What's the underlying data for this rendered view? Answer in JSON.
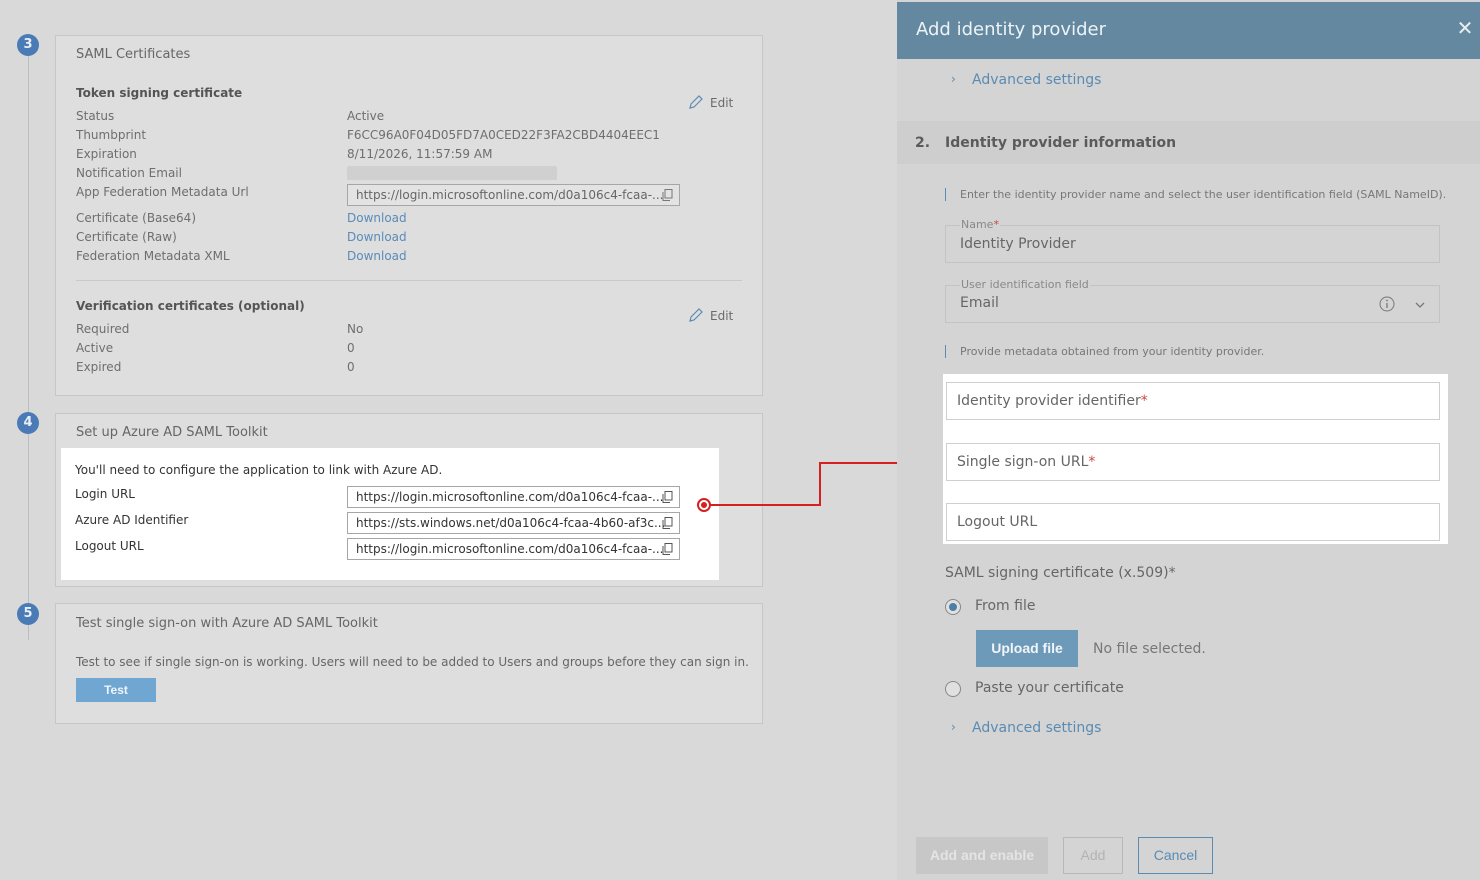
{
  "left": {
    "steps": [
      "3",
      "4",
      "5"
    ],
    "saml_certs": {
      "title": "SAML Certificates",
      "token_signing": {
        "heading": "Token signing certificate",
        "edit_label": "Edit",
        "rows": [
          {
            "label": "Status",
            "value": "Active"
          },
          {
            "label": "Thumbprint",
            "value": "F6CC96A0F04D05FD7A0CED22F3FA2CBD4404EEC1"
          },
          {
            "label": "Expiration",
            "value": "8/11/2026, 11:57:59 AM"
          },
          {
            "label": "Notification Email",
            "value": ""
          },
          {
            "label": "App Federation Metadata Url",
            "value": "https://login.microsoftonline.com/d0a106c4-fcaa-..."
          },
          {
            "label": "Certificate (Base64)",
            "value": "Download"
          },
          {
            "label": "Certificate (Raw)",
            "value": "Download"
          },
          {
            "label": "Federation Metadata XML",
            "value": "Download"
          }
        ]
      },
      "verification": {
        "heading": "Verification certificates (optional)",
        "edit_label": "Edit",
        "rows": [
          {
            "label": "Required",
            "value": "No"
          },
          {
            "label": "Active",
            "value": "0"
          },
          {
            "label": "Expired",
            "value": "0"
          }
        ]
      }
    },
    "setup": {
      "title": "Set up Azure AD SAML Toolkit",
      "intro": "You'll need to configure the application to link with Azure AD.",
      "rows": [
        {
          "label": "Login URL",
          "value": "https://login.microsoftonline.com/d0a106c4-fcaa-..."
        },
        {
          "label": "Azure AD Identifier",
          "value": "https://sts.windows.net/d0a106c4-fcaa-4b60-af3c..."
        },
        {
          "label": "Logout URL",
          "value": "https://login.microsoftonline.com/d0a106c4-fcaa-..."
        }
      ]
    },
    "test": {
      "title": "Test single sign-on with Azure AD SAML Toolkit",
      "desc": "Test to see if single sign-on is working. Users will need to be added to Users and groups before they can sign in.",
      "button": "Test"
    }
  },
  "panel": {
    "title": "Add identity provider",
    "close": "✕",
    "advanced_top": "Advanced settings",
    "section_num": "2.",
    "section_title": "Identity provider information",
    "hint1": "Enter the identity provider name and select the user identification field (SAML NameID).",
    "name_label": "Name",
    "name_value": "Identity Provider",
    "uid_label": "User identification field",
    "uid_value": "Email",
    "hint2": "Provide metadata obtained from your identity provider.",
    "idp_identifier": "Identity provider identifier",
    "sso_url": "Single sign-on URL",
    "logout_url": "Logout URL",
    "required_mark": "*",
    "saml_cert_label": "SAML signing certificate (x.509)*",
    "from_file": "From file",
    "upload_btn": "Upload file",
    "no_file": "No file selected.",
    "paste_cert": "Paste your certificate",
    "advanced_bottom": "Advanced settings",
    "btn_add_enable": "Add and enable",
    "btn_add": "Add",
    "btn_cancel": "Cancel"
  },
  "colors": {
    "accent": "#5a8bb3",
    "header": "#63889f",
    "arrow": "#d42020"
  }
}
